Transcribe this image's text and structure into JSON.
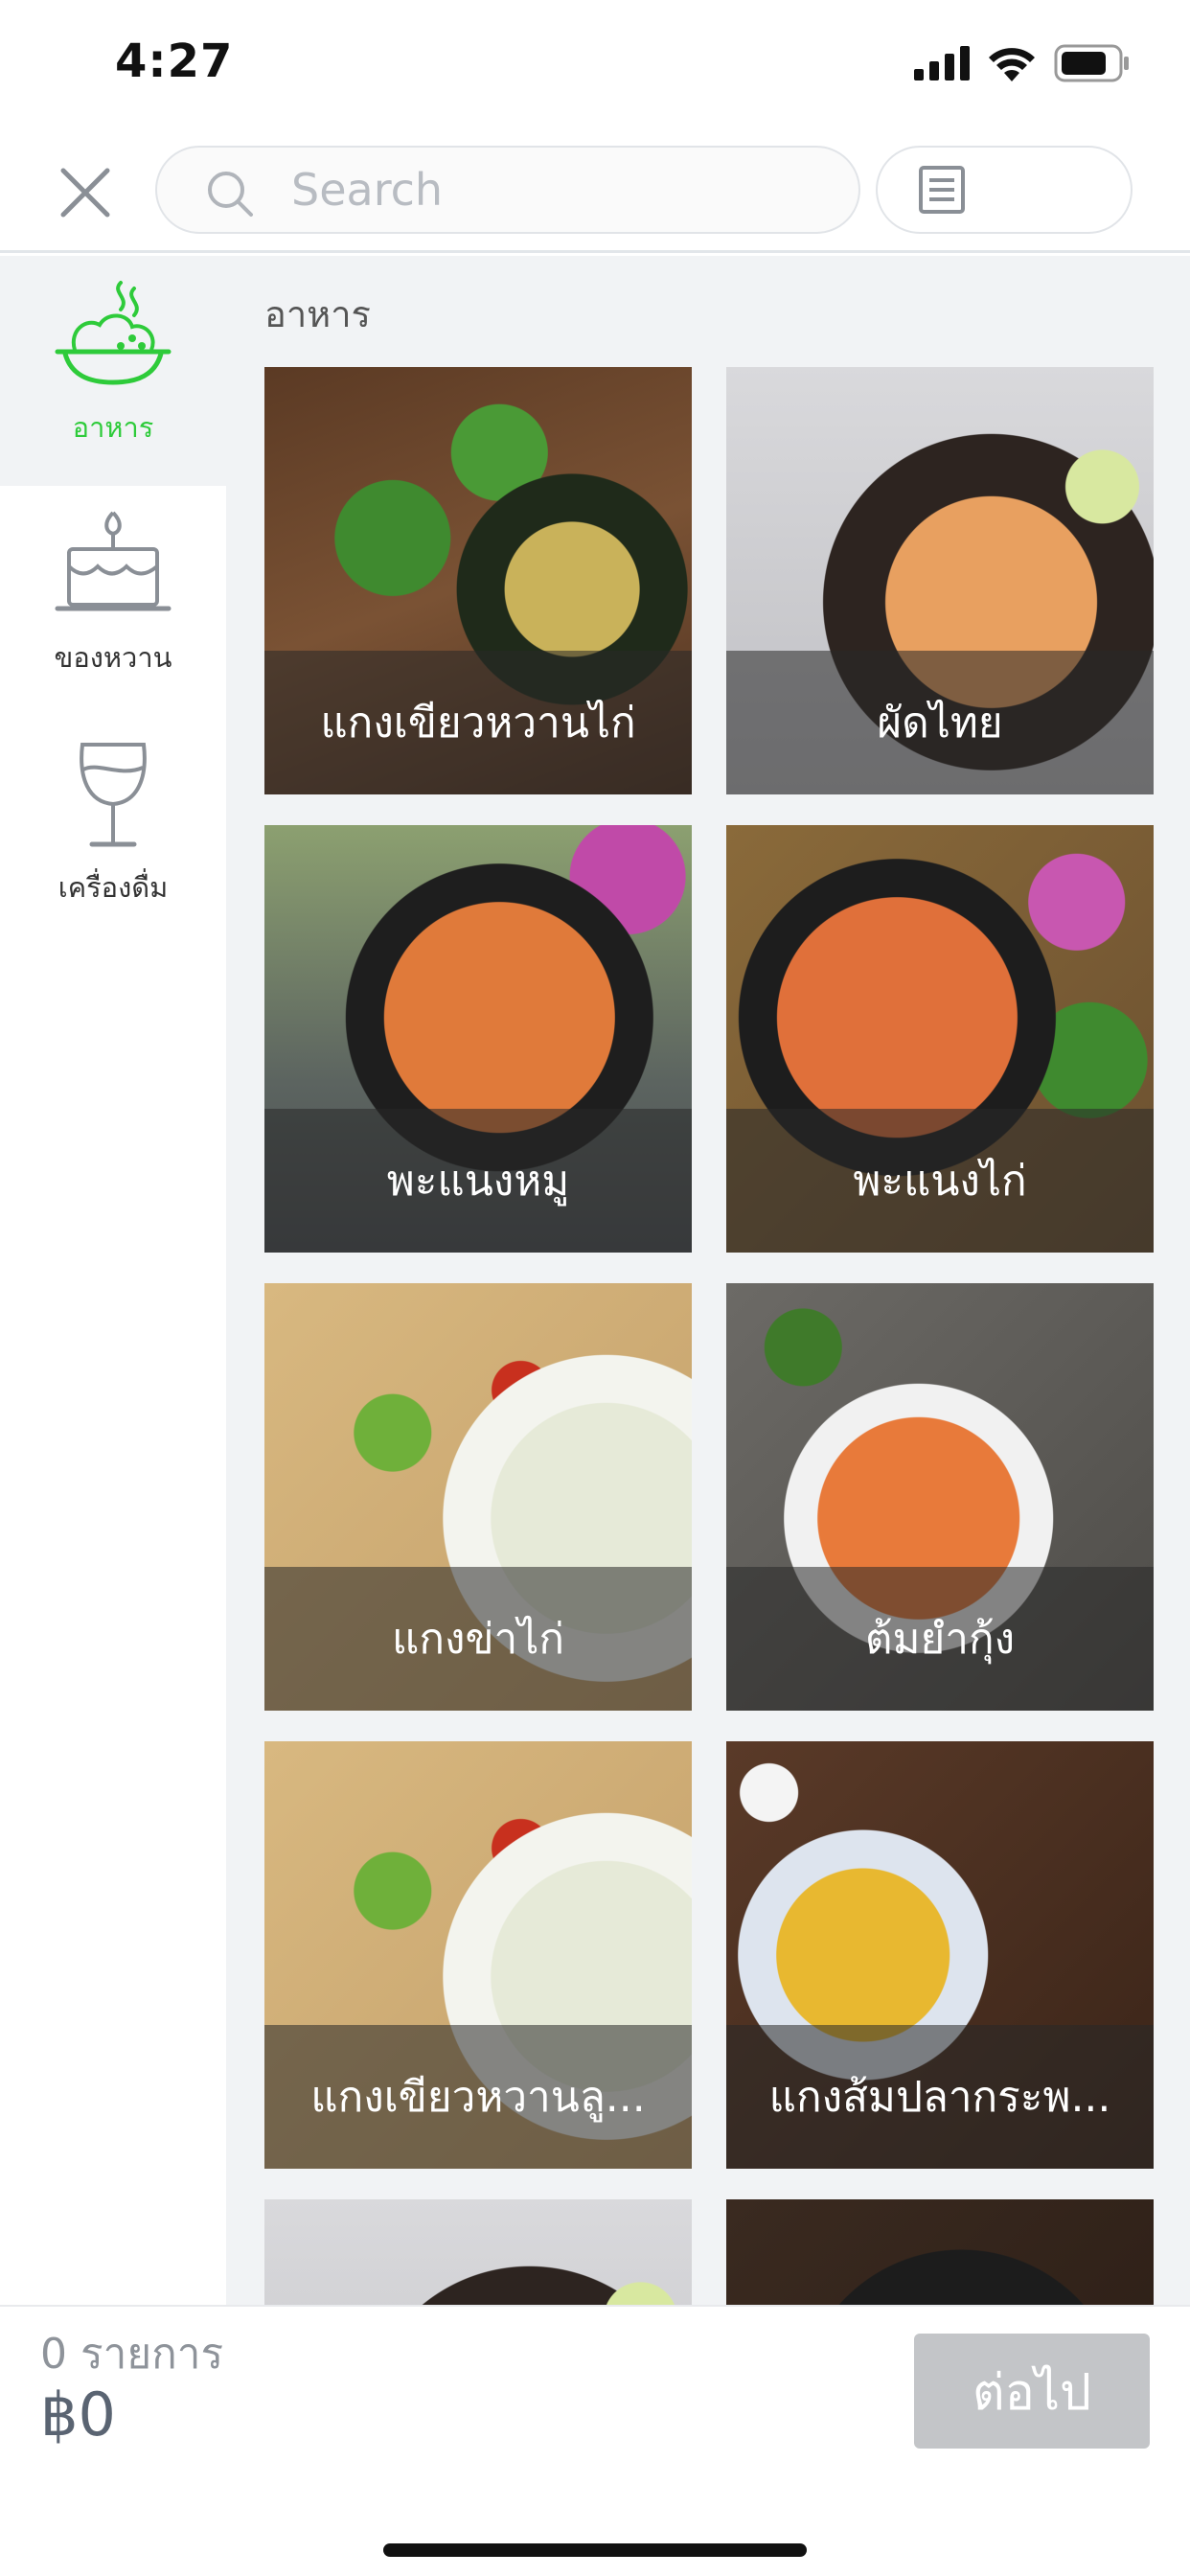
{
  "status_bar": {
    "time": "4:27"
  },
  "search": {
    "placeholder": "Search"
  },
  "colors": {
    "accent": "#2ecb3a",
    "disabled_button": "#c3c5c8"
  },
  "sidebar": {
    "items": [
      {
        "label": "อาหาร",
        "icon": "food-bowl-icon",
        "active": true
      },
      {
        "label": "ของหวาน",
        "icon": "cake-icon",
        "active": false
      },
      {
        "label": "เครื่องดื่ม",
        "icon": "wine-glass-icon",
        "active": false
      }
    ]
  },
  "main": {
    "section_title": "อาหาร",
    "items": [
      {
        "name": "แกงเขียวหวานไก่"
      },
      {
        "name": "ผัดไทย"
      },
      {
        "name": "พะแนงหมู"
      },
      {
        "name": "พะแนงไก่"
      },
      {
        "name": "แกงข่าไก่"
      },
      {
        "name": "ต้มยำกุ้ง"
      },
      {
        "name": "แกงเขียวหวานลู..."
      },
      {
        "name": "แกงส้มปลากระพ..."
      },
      {
        "name": ""
      },
      {
        "name": ""
      }
    ]
  },
  "cart": {
    "count_label": "0 รายการ",
    "total": "฿0",
    "next_label": "ต่อไป"
  }
}
